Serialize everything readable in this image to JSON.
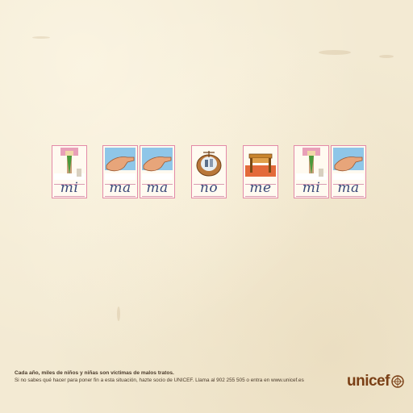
{
  "cards": [
    {
      "syllable": "mi",
      "icon": "flag-icon"
    },
    {
      "syllable": "ma",
      "icon": "hand-icon"
    },
    {
      "syllable": "ma",
      "icon": "hand-icon"
    },
    {
      "syllable": "no",
      "icon": "basket-icon"
    },
    {
      "syllable": "me",
      "icon": "table-icon"
    },
    {
      "syllable": "mi",
      "icon": "flag-icon"
    },
    {
      "syllable": "ma",
      "icon": "hand-icon"
    }
  ],
  "footer": {
    "line1": "Cada año, miles de niños y niñas son víctimas de malos tratos.",
    "line2": "Si no sabes qué hacer para poner fin a esta situación, hazte socio de UNICEF. Llama al 902 255 505 o entra en www.unicef.es"
  },
  "logo": {
    "text": "unicef",
    "color": "#7a3f15"
  },
  "colors": {
    "paper": "#f3ead3",
    "card_border": "#e38aa8",
    "script": "#3a4a7a"
  }
}
